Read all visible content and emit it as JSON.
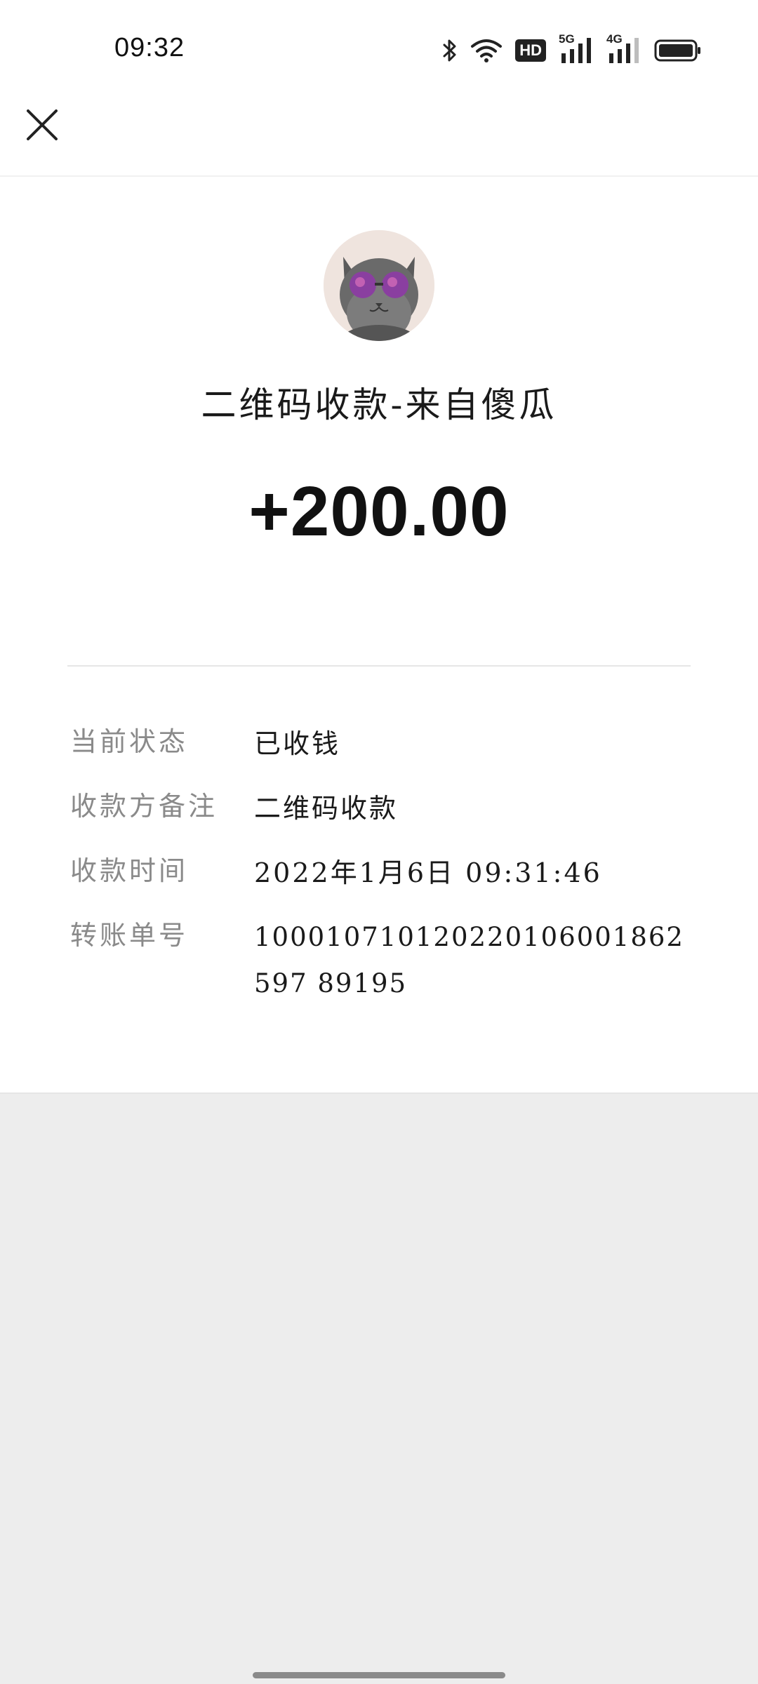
{
  "status_bar": {
    "time": "09:32",
    "icons": [
      "bluetooth-icon",
      "wifi-icon",
      "hd-icon",
      "signal-5g-icon",
      "signal-4g-icon",
      "battery-icon"
    ],
    "hd_label": "HD",
    "net1_label": "5G",
    "net2_label": "4G"
  },
  "nav": {
    "close_icon": "close-icon"
  },
  "header": {
    "title": "二维码收款-来自傻瓜",
    "amount": "+200.00"
  },
  "details": [
    {
      "label": "当前状态",
      "value": "已收钱"
    },
    {
      "label": "收款方备注",
      "value": "二维码收款"
    },
    {
      "label": "收款时间",
      "value": "2022年1月6日 09:31:46"
    },
    {
      "label": "转账单号",
      "value": "100010710120220106001862597 89195"
    }
  ],
  "colors": {
    "background": "#ededed",
    "card": "#ffffff",
    "label_gray": "#8a8a8a",
    "text_dark": "#1a1a1a"
  }
}
